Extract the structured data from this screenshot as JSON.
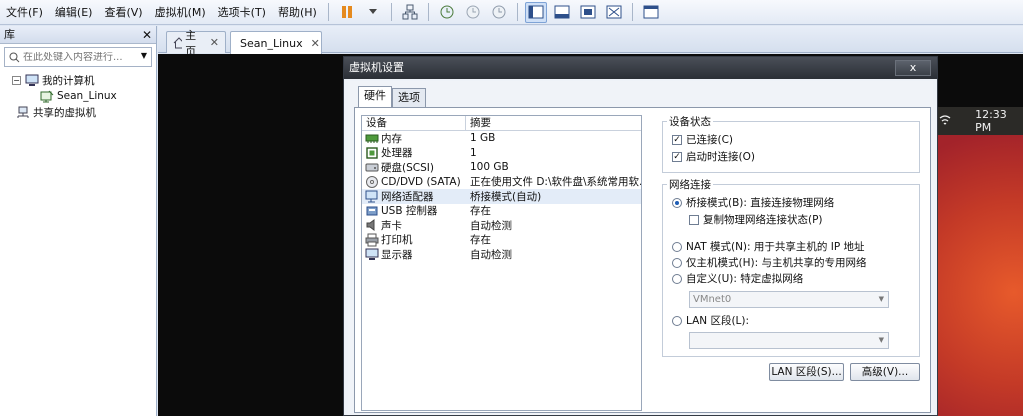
{
  "menu": [
    "文件(F)",
    "编辑(E)",
    "查看(V)",
    "虚拟机(M)",
    "选项卡(T)",
    "帮助(H)"
  ],
  "library": {
    "title": "库",
    "search_placeholder": "在此处键入内容进行...",
    "tree": {
      "my_computer": "我的计算机",
      "vm": "Sean_Linux",
      "shared": "共享的虚拟机"
    }
  },
  "tabs": [
    {
      "label": "主页"
    },
    {
      "label": "Sean_Linux"
    }
  ],
  "ubuntu": {
    "time": "12:33 PM"
  },
  "dialog": {
    "title": "虚拟机设置",
    "close": "x",
    "tabs": [
      "硬件",
      "选项"
    ],
    "table": {
      "col_device": "设备",
      "col_summary": "摘要",
      "rows": [
        {
          "name": "内存",
          "summary": "1 GB",
          "icon": "memory-icon"
        },
        {
          "name": "处理器",
          "summary": "1",
          "icon": "cpu-icon"
        },
        {
          "name": "硬盘(SCSI)",
          "summary": "100 GB",
          "icon": "harddisk-icon"
        },
        {
          "name": "CD/DVD (SATA)",
          "summary": "正在使用文件 D:\\软件盘\\系统常用软...",
          "icon": "cdrom-icon"
        },
        {
          "name": "网络适配器",
          "summary": "桥接模式(自动)",
          "icon": "network-icon"
        },
        {
          "name": "USB 控制器",
          "summary": "存在",
          "icon": "usb-icon"
        },
        {
          "name": "声卡",
          "summary": "自动检测",
          "icon": "sound-icon"
        },
        {
          "name": "打印机",
          "summary": "存在",
          "icon": "printer-icon"
        },
        {
          "name": "显示器",
          "summary": "自动检测",
          "icon": "display-icon"
        }
      ]
    },
    "device_status": {
      "title": "设备状态",
      "connected": "已连接(C)",
      "connect_on_power": "启动时连接(O)"
    },
    "network": {
      "title": "网络连接",
      "bridged": "桥接模式(B): 直接连接物理网络",
      "replicate": "复制物理网络连接状态(P)",
      "nat": "NAT 模式(N): 用于共享主机的 IP 地址",
      "hostonly": "仅主机模式(H): 与主机共享的专用网络",
      "custom": "自定义(U): 特定虚拟网络",
      "vmnet": "VMnet0",
      "lan": "LAN 区段(L):",
      "lan_value": ""
    },
    "buttons": {
      "lan_segments": "LAN 区段(S)...",
      "advanced": "高级(V)..."
    }
  }
}
